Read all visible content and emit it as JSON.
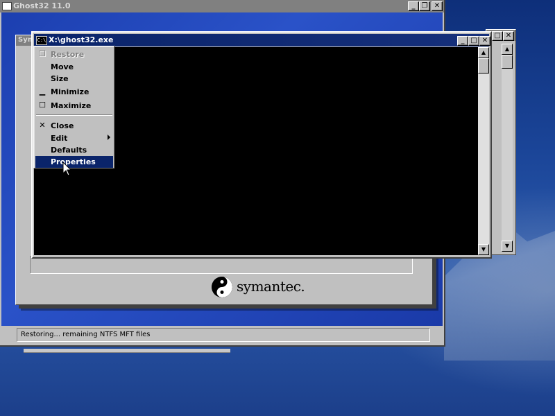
{
  "ghost_window": {
    "title": "Ghost32 11.0",
    "status_text": "Restoring... remaining NTFS MFT files"
  },
  "symantec_dialog": {
    "title_partial": "Sym",
    "logo_text": "symantec."
  },
  "console_window": {
    "title": "X:\\ghost32.exe",
    "icon_text": "C:\\"
  },
  "system_menu": {
    "items": [
      {
        "label": "Restore",
        "icon": "restore-icon",
        "state": "disabled"
      },
      {
        "label": "Move",
        "icon": "",
        "state": "normal"
      },
      {
        "label": "Size",
        "icon": "",
        "state": "normal"
      },
      {
        "label": "Minimize",
        "icon": "minimize-icon",
        "state": "normal"
      },
      {
        "label": "Maximize",
        "icon": "maximize-icon",
        "state": "normal"
      },
      {
        "label": "Close",
        "icon": "close-icon",
        "state": "normal"
      },
      {
        "label": "Edit",
        "icon": "submenu-arrow-icon",
        "state": "normal"
      },
      {
        "label": "Defaults",
        "icon": "",
        "state": "normal"
      },
      {
        "label": "Properties",
        "icon": "",
        "state": "selected"
      }
    ]
  },
  "colors": {
    "active_title": "#0a246a",
    "inactive_title": "#808080",
    "face": "#c0c0c0",
    "console_bg": "#000000",
    "desktop": "#1a4497"
  }
}
